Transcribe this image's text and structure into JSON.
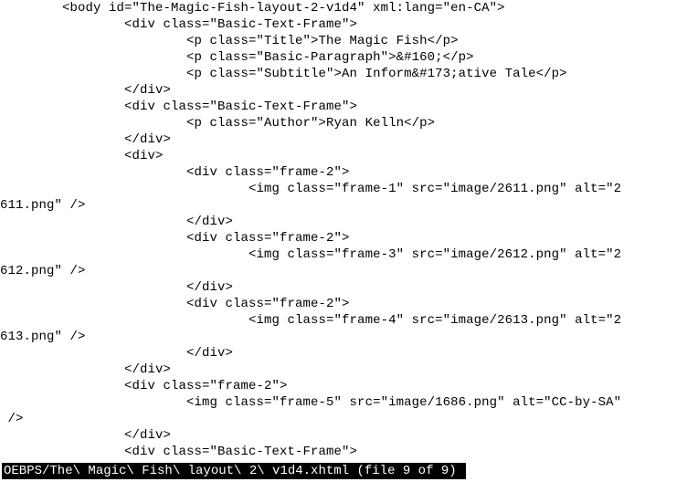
{
  "lines": {
    "l1": "        <body id=\"The-Magic-Fish-layout-2-v1d4\" xml:lang=\"en-CA\">",
    "l2": "                <div class=\"Basic-Text-Frame\">",
    "l3": "                        <p class=\"Title\">The Magic Fish</p>",
    "l4": "                        <p class=\"Basic-Paragraph\">&#160;</p>",
    "l5": "                        <p class=\"Subtitle\">An Inform&#173;ative Tale</p>",
    "l6": "                </div>",
    "l7": "                <div class=\"Basic-Text-Frame\">",
    "l8": "                        <p class=\"Author\">Ryan Kelln</p>",
    "l9": "                </div>",
    "l10": "                <div>",
    "l11": "                        <div class=\"frame-2\">",
    "l12": "                                <img class=\"frame-1\" src=\"image/2611.png\" alt=\"2",
    "l13": "611.png\" />",
    "l14": "                        </div>",
    "l15": "                        <div class=\"frame-2\">",
    "l16": "                                <img class=\"frame-3\" src=\"image/2612.png\" alt=\"2",
    "l17": "612.png\" />",
    "l18": "                        </div>",
    "l19": "                        <div class=\"frame-2\">",
    "l20": "                                <img class=\"frame-4\" src=\"image/2613.png\" alt=\"2",
    "l21": "613.png\" />",
    "l22": "                        </div>",
    "l23": "                </div>",
    "l24": "                <div class=\"frame-2\">",
    "l25": "                        <img class=\"frame-5\" src=\"image/1686.png\" alt=\"CC-by-SA\"",
    "l26": " />",
    "l27": "                </div>",
    "l28": "                <div class=\"Basic-Text-Frame\">"
  },
  "status": {
    "text": "OEBPS/The\\ Magic\\ Fish\\ layout\\ 2\\ v1d4.xhtml (file 9 of 9) "
  }
}
